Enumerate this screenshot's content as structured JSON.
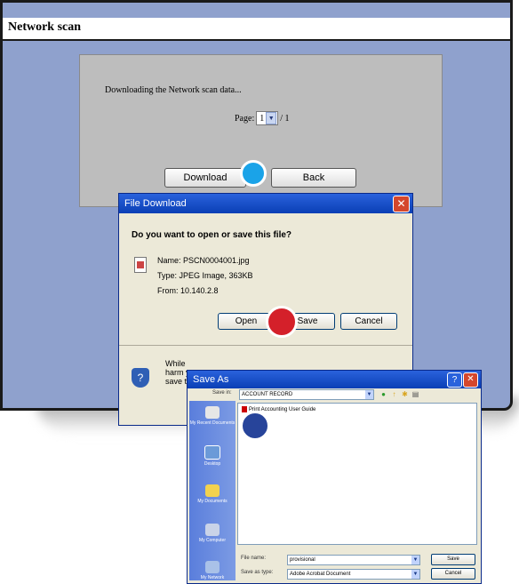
{
  "page": {
    "title": "Network scan",
    "message": "Downloading the Network scan data...",
    "page_label": "Page:",
    "page_value": "1",
    "page_total": "/ 1",
    "download_label": "Download",
    "back_label": "Back"
  },
  "file_download": {
    "title": "File Download",
    "question": "Do you want to open or save this file?",
    "name": "Name:  PSCN0004001.jpg",
    "type": "Type:  JPEG Image, 363KB",
    "from": "From:  10.140.2.8",
    "open_label": "Open",
    "save_label": "Save",
    "cancel_label": "Cancel",
    "warning_line1": "While",
    "warning_line2": "harm y",
    "warning_line3": "save t",
    "close_glyph": "✕"
  },
  "save_as": {
    "title": "Save As",
    "help_glyph": "?",
    "close_glyph": "✕",
    "save_in_label": "Save in:",
    "save_in_value": "ACCOUNT RECORD",
    "file_item": "Print Accounting User Guide",
    "places": [
      "My Recent Documents",
      "Desktop",
      "My Documents",
      "My Computer",
      "My Network"
    ],
    "file_name_label": "File name:",
    "file_name_value": "provisional",
    "save_type_label": "Save as type:",
    "save_type_value": "Adobe Acrobat Document",
    "save_label": "Save",
    "cancel_label": "Cancel"
  },
  "markers": {
    "blue_light": "#1aa3e8",
    "red": "#d4202a",
    "navy": "#27449a"
  }
}
